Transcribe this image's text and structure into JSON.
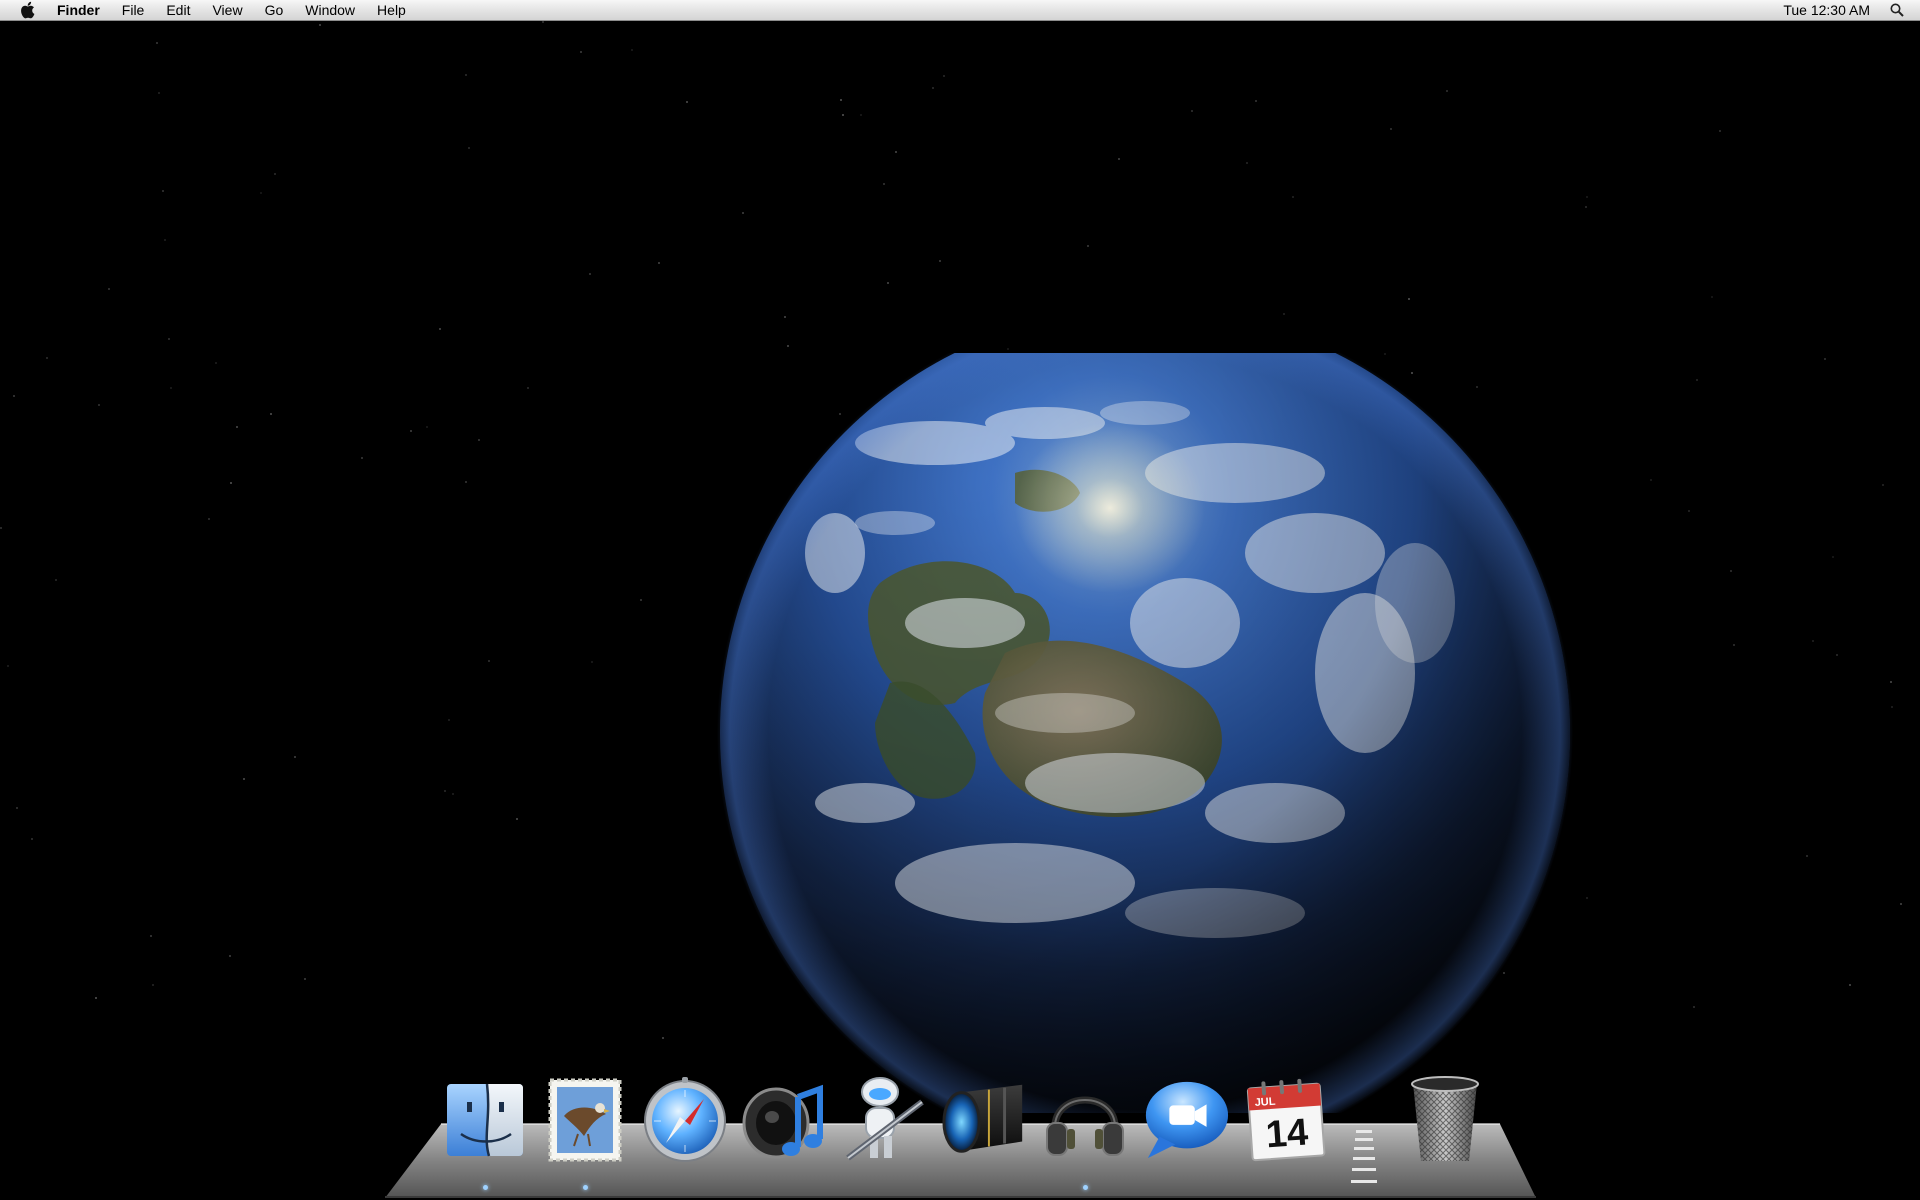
{
  "menubar": {
    "apple_icon": "apple-icon",
    "app_name": "Finder",
    "menus": [
      "File",
      "Edit",
      "View",
      "Go",
      "Window",
      "Help"
    ],
    "clock": "Tue 12:30 AM",
    "spotlight_icon": "magnifier-icon"
  },
  "desktop": {
    "wallpaper": "earth-from-space"
  },
  "dock": {
    "items": [
      {
        "name": "Finder",
        "icon": "finder-icon",
        "running": true
      },
      {
        "name": "Mail",
        "icon": "mail-stamp-icon",
        "running": true
      },
      {
        "name": "Safari",
        "icon": "compass-icon",
        "running": false
      },
      {
        "name": "iTunes",
        "icon": "speaker-music-note-icon",
        "running": false
      },
      {
        "name": "Automator",
        "icon": "robot-icon",
        "running": false
      },
      {
        "name": "Aperture",
        "icon": "camera-lens-icon",
        "running": false
      },
      {
        "name": "GarageBand",
        "icon": "headphones-icon",
        "running": true
      },
      {
        "name": "iChat",
        "icon": "video-chat-bubble-icon",
        "running": false
      },
      {
        "name": "iCal",
        "icon": "calendar-icon",
        "running": false
      },
      {
        "name": "Trash",
        "icon": "trash-icon",
        "running": false
      }
    ],
    "calendar": {
      "month": "JUL",
      "day": "14"
    }
  },
  "colors": {
    "menubar_top": "#f7f7f7",
    "menubar_bottom": "#d4d4d4",
    "desktop_bg": "#000000",
    "ocean": "#2a5db0",
    "cloud": "#e8eef5",
    "land": "#6b6a4a"
  }
}
